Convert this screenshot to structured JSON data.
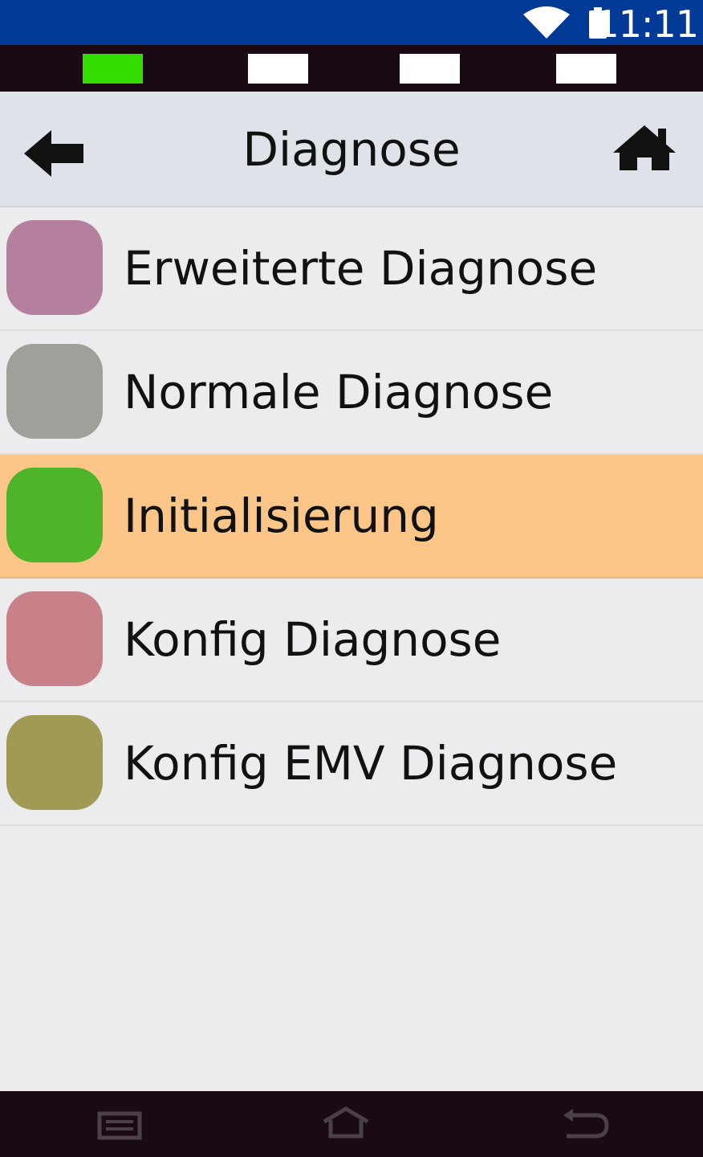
{
  "status_bar": {
    "time": "11:11",
    "icons": [
      "wifi-icon",
      "battery-icon"
    ],
    "background": "#003a96"
  },
  "indicators": [
    {
      "color": "#33dd00",
      "state": "active"
    },
    {
      "color": "#ffffff",
      "state": "inactive"
    },
    {
      "color": "#ffffff",
      "state": "inactive"
    },
    {
      "color": "#ffffff",
      "state": "inactive"
    }
  ],
  "header": {
    "title": "Diagnose",
    "back_icon": "arrow-left-icon",
    "home_icon": "home-icon"
  },
  "menu": {
    "items": [
      {
        "label": "Erweiterte Diagnose",
        "color": "#b5809e",
        "selected": false
      },
      {
        "label": "Normale Diagnose",
        "color": "#a19f9a",
        "selected": false
      },
      {
        "label": "Initialisierung",
        "color": "#4eb52a",
        "selected": true
      },
      {
        "label": "Konfig Diagnose",
        "color": "#c98189",
        "selected": false
      },
      {
        "label": "Konfig EMV Diagnose",
        "color": "#a09a55",
        "selected": false
      }
    ],
    "selected_background": "#fdc689"
  },
  "nav_bar": {
    "icons": [
      "recent-apps-icon",
      "home-outline-icon",
      "back-return-icon"
    ]
  }
}
